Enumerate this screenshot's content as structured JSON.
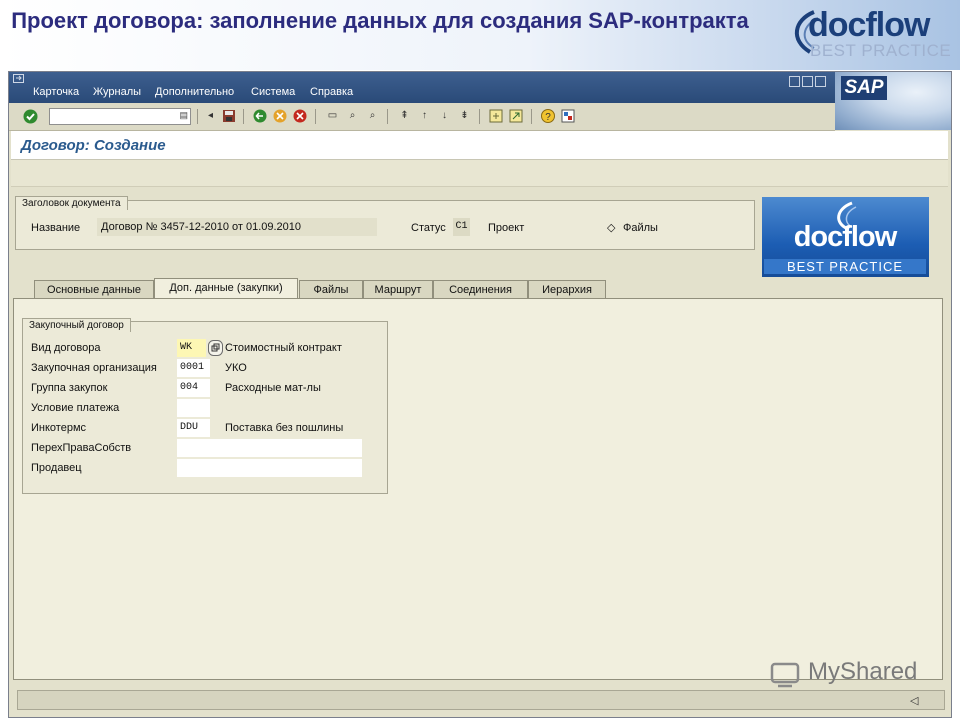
{
  "slide": {
    "title": "Проект договора: заполнение данных для создания SAP-контракта",
    "logo_word": "docflow",
    "logo_sub": "BEST PRACTICE"
  },
  "menu": [
    "Карточка",
    "Журналы",
    "Дополнительно",
    "Система",
    "Справка"
  ],
  "sap_logo": "SAP",
  "toolbar": {
    "icons": [
      "check-icon",
      "command-field",
      "back-arrow-icon",
      "save-icon",
      "back-icon",
      "exit-icon",
      "cancel-icon",
      "print-icon",
      "find-icon",
      "find-next-icon",
      "first-page-icon",
      "prev-page-icon",
      "next-page-icon",
      "last-page-icon",
      "new-session-icon",
      "shortcut-icon",
      "help-icon",
      "layout-icon"
    ]
  },
  "screen_title": "Договор: Создание",
  "header_group": {
    "tab_label": "Заголовок документа",
    "name_label": "Название",
    "name_value": "Договор № 3457-12-2010 от 01.09.2010",
    "status_label": "Статус",
    "status_value": "C1",
    "project_label": "Проект",
    "files_label": "Файлы",
    "files_icon": "◇"
  },
  "doc_logo": {
    "word": "docflow",
    "sub": "BEST PRACTICE"
  },
  "tabs": [
    "Основные данные",
    "Доп. данные (закупки)",
    "Файлы",
    "Маршрут",
    "Соединения",
    "Иерархия"
  ],
  "active_tab": "Доп. данные (закупки)",
  "purchase_group": {
    "title": "Закупочный договор",
    "rows": [
      {
        "label": "Вид договора",
        "value": "WK",
        "desc": "Стоимостный контракт"
      },
      {
        "label": "Закупочная организация",
        "value": "0001",
        "desc": "УКО"
      },
      {
        "label": "Группа закупок",
        "value": "004",
        "desc": "Расходные мат-лы"
      },
      {
        "label": "Условие платежа",
        "value": "",
        "desc": ""
      },
      {
        "label": "Инкотермс",
        "value": "DDU",
        "desc": "Поставка без пошлины"
      },
      {
        "label": "ПерехПраваСобств",
        "value": "",
        "desc": ""
      },
      {
        "label": "Продавец",
        "value": "",
        "desc": ""
      }
    ]
  },
  "watermark": "MyShared"
}
